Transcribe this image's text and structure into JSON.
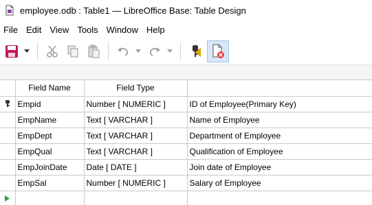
{
  "window": {
    "title": "employee.odb : Table1 — LibreOffice Base: Table Design"
  },
  "menu": [
    "File",
    "Edit",
    "View",
    "Tools",
    "Window",
    "Help"
  ],
  "toolbar": {
    "icons": [
      "save-icon",
      "dropdown-arrow-icon",
      "cut-icon",
      "copy-icon",
      "paste-icon",
      "undo-icon",
      "redo-icon",
      "primary-key-icon",
      "index-design-icon"
    ],
    "colors": {
      "save": "#c2185b",
      "primary_key": "#e0a400",
      "active_bg": "#d8e7f7"
    }
  },
  "table": {
    "headers": [
      "Field Name",
      "Field Type",
      ""
    ],
    "rows": [
      {
        "name": "Empid",
        "type": "Number [ NUMERIC ]",
        "description": "ID of Employee(Primary Key)",
        "primary_key": true
      },
      {
        "name": "EmpName",
        "type": "Text [ VARCHAR ]",
        "description": "Name of Employee",
        "primary_key": false
      },
      {
        "name": "EmpDept",
        "type": "Text [ VARCHAR ]",
        "description": "Department of Employee",
        "primary_key": false
      },
      {
        "name": "EmpQual",
        "type": "Text [ VARCHAR ]",
        "description": "Qualification of Employee",
        "primary_key": false
      },
      {
        "name": "EmpJoinDate",
        "type": "Date [ DATE ]",
        "description": "Join date of Employee",
        "primary_key": false
      },
      {
        "name": "EmpSal",
        "type": "Number [ NUMERIC ]",
        "description": "Salary of Employee",
        "primary_key": false
      }
    ],
    "new_row_indicator": "green-arrow-icon"
  }
}
